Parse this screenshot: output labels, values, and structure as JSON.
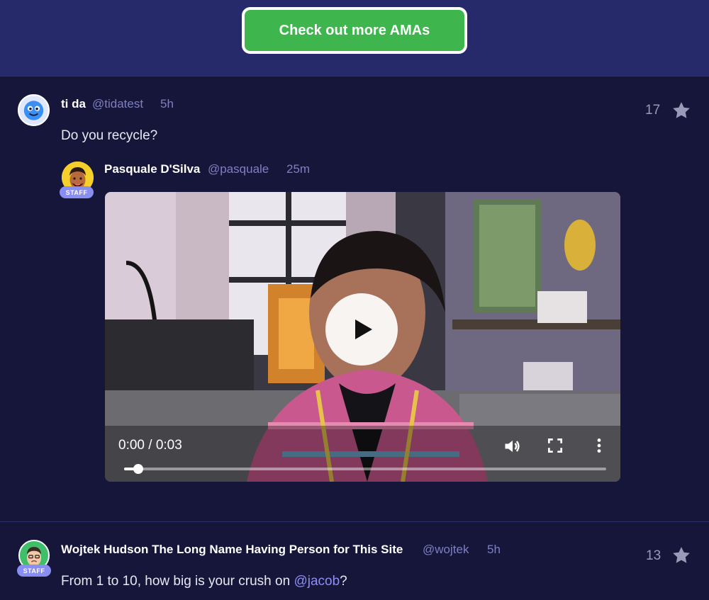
{
  "banner": {
    "button_label": "Check out more AMAs",
    "button_color": "#3fb64d"
  },
  "question1": {
    "author_name": "ti da",
    "author_handle": "@tidatest",
    "time": "5h",
    "text": "Do you recycle?",
    "star_count": "17",
    "avatar_icon": "blue-smiley-avatar"
  },
  "answer1": {
    "author_name": "Pasquale D'Silva",
    "author_handle": "@pasquale",
    "time": "25m",
    "badge": "STAFF",
    "avatar_icon": "bearded-man-avatar",
    "video": {
      "time_display": "0:00 / 0:03",
      "progress": 0.03,
      "play_icon": "play-icon",
      "volume_icon": "volume-icon",
      "fullscreen_icon": "fullscreen-icon",
      "menu_icon": "more-vertical-icon"
    }
  },
  "question2": {
    "author_name": "Wojtek Hudson The Long Name Having Person for This Site",
    "author_handle": "@wojtek",
    "time": "5h",
    "text_before": "From 1 to 10, how big is your crush on ",
    "mention": "@jacob",
    "text_after": "?",
    "star_count": "13",
    "badge": "STAFF",
    "avatar_icon": "green-face-avatar"
  },
  "colors": {
    "background": "#16163a",
    "banner": "#26296a",
    "handle": "#7f7fc4",
    "badge": "#8a8ef2",
    "star": "#9a9ab8"
  }
}
